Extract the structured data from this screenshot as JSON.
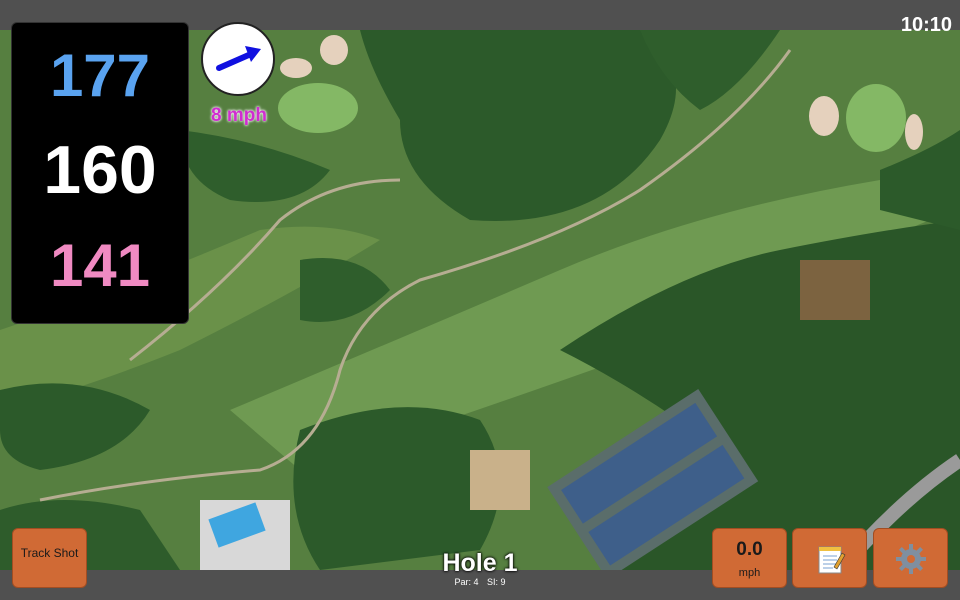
{
  "status": {
    "clock": "10:10"
  },
  "distances": {
    "back": "177",
    "middle": "160",
    "front": "141"
  },
  "wind": {
    "speed": "8 mph",
    "arrow_icon": "wind-direction-arrow",
    "arrow_color": "#1010e0"
  },
  "hole": {
    "title": "Hole 1",
    "par": "Par: 4",
    "stroke_index": "SI: 9"
  },
  "buttons": {
    "track_shot": "Track Shot",
    "speed_value": "0.0",
    "speed_unit": "mph",
    "notes_icon": "notepad-icon",
    "settings_icon": "gear-icon"
  },
  "colors": {
    "button": "#d06a35",
    "back": "#5aa3f0",
    "middle": "#ffffff",
    "front": "#f08ac2",
    "wind_text": "#d02dd0"
  }
}
